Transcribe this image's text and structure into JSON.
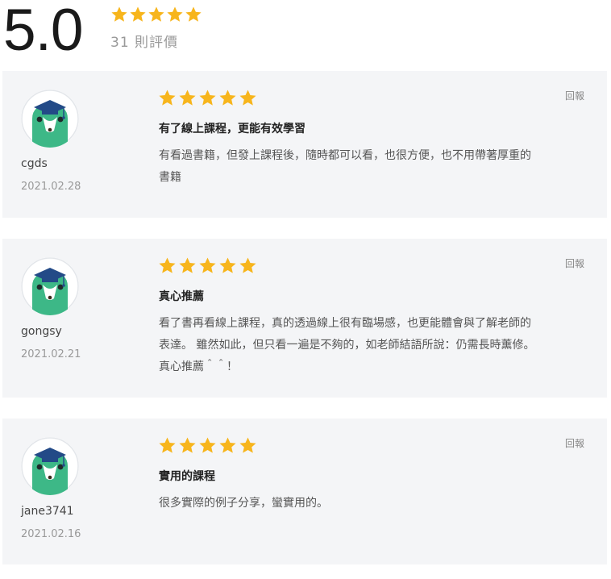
{
  "summary": {
    "score": "5.0",
    "stars": 5,
    "count_text": "31 則評價"
  },
  "colors": {
    "star": "#f7b51c",
    "card_bg": "#f4f5f7",
    "avatar_body": "#3db887",
    "cap": "#234a87"
  },
  "icons": {
    "star": "star-icon",
    "avatar": "mascot-avatar-icon"
  },
  "reviews": [
    {
      "user": "cgds",
      "date": "2021.02.28",
      "rating": 5,
      "report_label": "回報",
      "title": "有了線上課程，更能有效學習",
      "lines": [
        "有看過書籍，但發上課程後，隨時都可以看，也很方便，也不用帶著厚重的",
        "書籍"
      ]
    },
    {
      "user": "gongsy",
      "date": "2021.02.21",
      "rating": 5,
      "report_label": "回報",
      "title": "真心推薦",
      "lines": [
        "看了書再看線上課程，真的透過線上很有臨場感，也更能體會與了解老師的",
        "表達。 雖然如此，但只看一遍是不夠的，如老師結語所說：仍需長時薰修。",
        "真心推薦＾＾！"
      ]
    },
    {
      "user": "jane3741",
      "date": "2021.02.16",
      "rating": 5,
      "report_label": "回報",
      "title": "實用的課程",
      "lines": [
        "很多實際的例子分享，蠻實用的。"
      ]
    }
  ]
}
